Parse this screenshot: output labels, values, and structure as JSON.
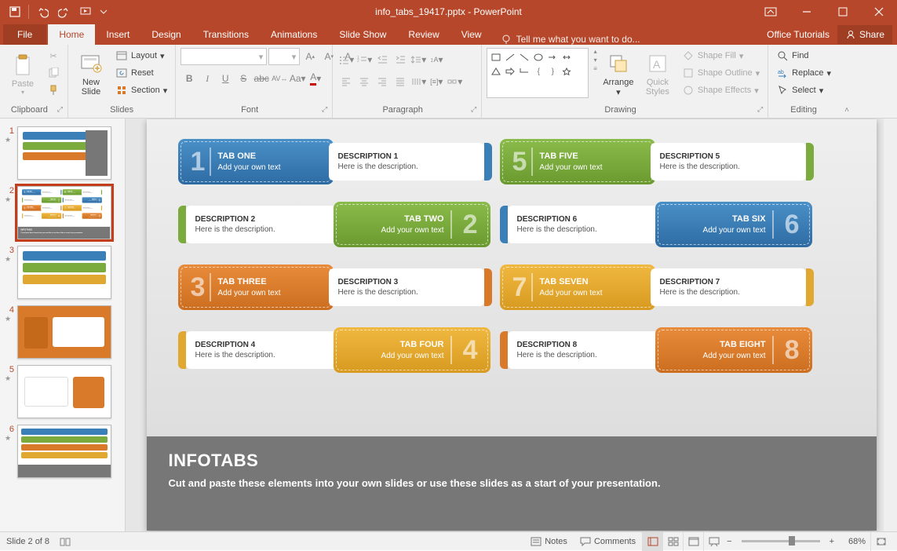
{
  "app": {
    "title": "info_tabs_19417.pptx - PowerPoint"
  },
  "qat": {
    "save": "Save",
    "undo": "Undo",
    "redo": "Redo",
    "start": "Start From Beginning"
  },
  "tabs": {
    "file": "File",
    "home": "Home",
    "insert": "Insert",
    "design": "Design",
    "transitions": "Transitions",
    "animations": "Animations",
    "slideshow": "Slide Show",
    "review": "Review",
    "view": "View",
    "tellme": "Tell me what you want to do...",
    "tutorials": "Office Tutorials",
    "share": "Share"
  },
  "ribbon": {
    "clipboard": {
      "paste": "Paste",
      "cut": "Cut",
      "copy": "Copy",
      "painter": "Format Painter",
      "label": "Clipboard"
    },
    "slides": {
      "new": "New\nSlide",
      "layout": "Layout",
      "reset": "Reset",
      "section": "Section",
      "label": "Slides"
    },
    "font": {
      "label": "Font"
    },
    "paragraph": {
      "label": "Paragraph"
    },
    "drawing": {
      "arrange": "Arrange",
      "quick": "Quick\nStyles",
      "fill": "Shape Fill",
      "outline": "Shape Outline",
      "effects": "Shape Effects",
      "label": "Drawing"
    },
    "editing": {
      "find": "Find",
      "replace": "Replace",
      "select": "Select",
      "label": "Editing"
    }
  },
  "slide": {
    "tabs": [
      {
        "num": "1",
        "title": "TAB ONE",
        "sub": "Add your own text",
        "desc_t": "DESCRIPTION 1",
        "desc_s": "Here is the description."
      },
      {
        "num": "2",
        "title": "TAB TWO",
        "sub": "Add your own text",
        "desc_t": "DESCRIPTION 2",
        "desc_s": "Here is the description."
      },
      {
        "num": "3",
        "title": "TAB THREE",
        "sub": "Add your own text",
        "desc_t": "DESCRIPTION 3",
        "desc_s": "Here is the description."
      },
      {
        "num": "4",
        "title": "TAB FOUR",
        "sub": "Add your own text",
        "desc_t": "DESCRIPTION 4",
        "desc_s": "Here is the description."
      },
      {
        "num": "5",
        "title": "TAB FIVE",
        "sub": "Add your own text",
        "desc_t": "DESCRIPTION 5",
        "desc_s": "Here is the description."
      },
      {
        "num": "6",
        "title": "TAB SIX",
        "sub": "Add your own text",
        "desc_t": "DESCRIPTION 6",
        "desc_s": "Here is the description."
      },
      {
        "num": "7",
        "title": "TAB SEVEN",
        "sub": "Add your own text",
        "desc_t": "DESCRIPTION 7",
        "desc_s": "Here is the description."
      },
      {
        "num": "8",
        "title": "TAB EIGHT",
        "sub": "Add your own text",
        "desc_t": "DESCRIPTION 8",
        "desc_s": "Here is the description."
      }
    ],
    "footer_title": "INFOTABS",
    "footer_text": "Cut and paste these elements into your own slides or use these slides as a start of your presentation."
  },
  "thumbs": [
    "1",
    "2",
    "3",
    "4",
    "5",
    "6"
  ],
  "status": {
    "slide": "Slide 2 of 8",
    "notes": "Notes",
    "comments": "Comments",
    "zoom": "68%"
  }
}
